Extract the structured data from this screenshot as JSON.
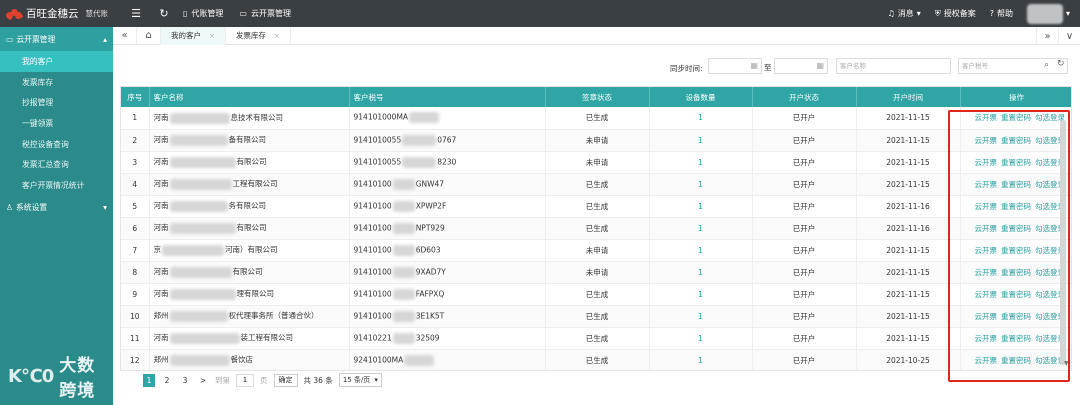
{
  "brand": {
    "name": "百旺金穗云",
    "sub": "慧代账"
  },
  "topnav": {
    "items": [
      {
        "icon": "▯",
        "label": "代账管理"
      },
      {
        "icon": "▭",
        "label": "云开票管理"
      }
    ],
    "right": [
      {
        "icon": "♫",
        "label": "消息",
        "caret": "▾"
      },
      {
        "icon": "⛨",
        "label": "授权备案"
      },
      {
        "icon": "?",
        "label": "帮助"
      }
    ],
    "caret": "▾"
  },
  "sidebar": {
    "group1": {
      "label": "云开票管理",
      "caret": "▴"
    },
    "items": [
      {
        "label": "我的客户",
        "active": true
      },
      {
        "label": "发票库存"
      },
      {
        "label": "抄报管理"
      },
      {
        "label": "一键领票"
      },
      {
        "label": "税控设备查询"
      },
      {
        "label": "发票汇总查询"
      },
      {
        "label": "客户开票情况统计"
      }
    ],
    "group2": {
      "label": "系统设置",
      "caret": "▾"
    }
  },
  "watermark": {
    "logo": "K℃0",
    "text": "大数跨境"
  },
  "tabs": {
    "nav_back": "«",
    "home": "⌂",
    "items": [
      {
        "label": "我的客户",
        "close": "×"
      },
      {
        "label": "发票库存",
        "close": "×"
      }
    ],
    "nav_forward": "»",
    "dropdown": "∨"
  },
  "filter": {
    "sync_label": "同步时间:",
    "to_label": "至",
    "customer_name_placeholder": "客户名称",
    "tax_no_placeholder": "客户税号",
    "calendar_icon": "▦",
    "search_icon": "⌕",
    "refresh_icon": "↻"
  },
  "table": {
    "headers": [
      "序号",
      "客户名称",
      "客户税号",
      "签章状态",
      "设备数量",
      "开户状态",
      "开户时间",
      "操作"
    ],
    "rows": [
      {
        "no": "1",
        "name_a": "河南",
        "name_b": "息技术有限公司",
        "tax_a": "914101000MA",
        "tax_b": "",
        "sign": "已生成",
        "devices": "1",
        "acct": "已开户",
        "date": "2021-11-15"
      },
      {
        "no": "2",
        "name_a": "河南",
        "name_b": "备有限公司",
        "tax_a": "9141010055",
        "tax_b": "0767",
        "sign": "未申请",
        "devices": "1",
        "acct": "已开户",
        "date": "2021-11-15"
      },
      {
        "no": "3",
        "name_a": "河南",
        "name_b": "有限公司",
        "tax_a": "9141010055",
        "tax_b": "8230",
        "sign": "未申请",
        "devices": "1",
        "acct": "已开户",
        "date": "2021-11-15"
      },
      {
        "no": "4",
        "name_a": "河南",
        "name_b": "工程有限公司",
        "tax_a": "91410100",
        "tax_b": "GNW47",
        "sign": "已生成",
        "devices": "1",
        "acct": "已开户",
        "date": "2021-11-15"
      },
      {
        "no": "5",
        "name_a": "河南",
        "name_b": "务有限公司",
        "tax_a": "91410100",
        "tax_b": "XPWP2F",
        "sign": "已生成",
        "devices": "1",
        "acct": "已开户",
        "date": "2021-11-16"
      },
      {
        "no": "6",
        "name_a": "河南",
        "name_b": "有限公司",
        "tax_a": "91410100",
        "tax_b": "NPT929",
        "sign": "已生成",
        "devices": "1",
        "acct": "已开户",
        "date": "2021-11-16"
      },
      {
        "no": "7",
        "name_a": "京",
        "name_b": "河南）有限公司",
        "tax_a": "91410100",
        "tax_b": "6D603",
        "sign": "未申请",
        "devices": "1",
        "acct": "已开户",
        "date": "2021-11-15"
      },
      {
        "no": "8",
        "name_a": "河南",
        "name_b": "有限公司",
        "tax_a": "91410100",
        "tax_b": "9XAD7Y",
        "sign": "未申请",
        "devices": "1",
        "acct": "已开户",
        "date": "2021-11-15"
      },
      {
        "no": "9",
        "name_a": "河南",
        "name_b": "理有限公司",
        "tax_a": "91410100",
        "tax_b": "FAFPXQ",
        "sign": "已生成",
        "devices": "1",
        "acct": "已开户",
        "date": "2021-11-15"
      },
      {
        "no": "10",
        "name_a": "郑州",
        "name_b": "权代理事务所（普通合伙）",
        "tax_a": "91410100",
        "tax_b": "3E1K5T",
        "sign": "已生成",
        "devices": "1",
        "acct": "已开户",
        "date": "2021-11-15"
      },
      {
        "no": "11",
        "name_a": "河南",
        "name_b": "装工程有限公司",
        "tax_a": "91410221",
        "tax_b": "32509",
        "sign": "已生成",
        "devices": "1",
        "acct": "已开户",
        "date": "2021-11-15"
      },
      {
        "no": "12",
        "name_a": "郑州",
        "name_b": "餐饮店",
        "tax_a": "92410100MA",
        "tax_b": "",
        "sign": "已生成",
        "devices": "1",
        "acct": "已开户",
        "date": "2021-10-25"
      }
    ],
    "ops": [
      "云开票",
      "重置密码",
      "勾选登录"
    ]
  },
  "pagination": {
    "first": "1",
    "pages": [
      "2",
      "3"
    ],
    "next": ">",
    "goto_label": "到第",
    "goto_value": "1",
    "page_unit": "页",
    "confirm": "确定",
    "total": "共 36 条",
    "page_size": "15 条/页",
    "page_size_caret": "▾"
  },
  "accent": {
    "teal": "#2fa5a5",
    "highlight": "#e0251b",
    "topbar": "#3a3f44"
  }
}
